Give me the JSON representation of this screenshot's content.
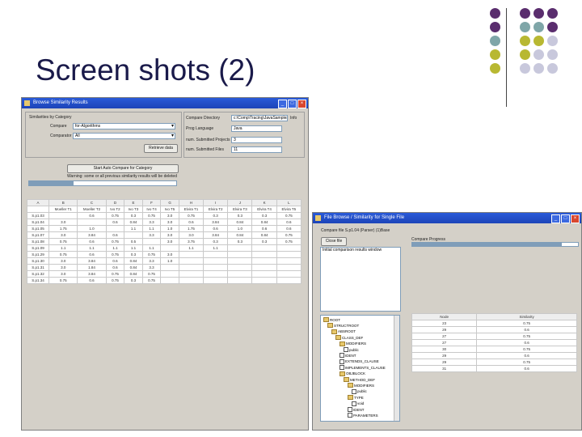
{
  "slide": {
    "title": "Screen shots (2)"
  },
  "colors": {
    "purple": "#5a2d6e",
    "teal": "#7fa6a8",
    "olive": "#b8b832",
    "lavender": "#c8c8dc",
    "titlebar": "#2a5ad8"
  },
  "win1": {
    "title": "Browse Similarity Results",
    "sim_group": "Similarities by Category",
    "compare_label": "Compare",
    "compare_value": "for-Algorithms",
    "comparator_label": "Comparator",
    "comparator_value": "All",
    "retrieve_btn": "Retrieve data",
    "compare_dir_label": "Compare Directory",
    "compare_dir_value": "c:\\Comp\\Tracing\\JavaSamples",
    "info_btn": "Info",
    "prog_lang_label": "Prog Language",
    "prog_lang_value": "Java",
    "num_projects_label": "num. Submitted Projects",
    "num_projects_value": "3",
    "num_files_label": "num. Submitted Files",
    "num_files_value": "11",
    "start_btn": "Start Auto Compare for Category",
    "warning": "Warning: some or all previous similarity results will be deleted",
    "progress": 0.3,
    "table": {
      "headers": [
        "A",
        "B",
        "C",
        "D",
        "E",
        "F",
        "G",
        "H",
        "I",
        "J",
        "K",
        "L"
      ],
      "subheaders": [
        "",
        "Moeller T1",
        "Moeller T2",
        "Ivo T2",
        "Ivo T3",
        "Ivo T4",
        "Ivo T5",
        "Elvira T1",
        "Elvira T2",
        "Elvira T3",
        "Elvira T4",
        "Elvira T5"
      ],
      "rows": [
        [
          "S.p1.03",
          "",
          "0.6",
          "0.75",
          "0.3",
          "0.75",
          "3.0",
          "0.75",
          "0.3",
          "0.3",
          "0.3",
          "0.75"
        ],
        [
          "S.p1.04",
          "3.0",
          "",
          "0.6",
          "0.84",
          "3.3",
          "3.0",
          "0.6",
          "3.84",
          "0.84",
          "0.84",
          "0.6"
        ],
        [
          "S.p1.05",
          "1.75",
          "1.0",
          "",
          "1.1",
          "1.1",
          "1.0",
          "1.75",
          "0.6",
          "1.0",
          "0.6",
          "0.6"
        ],
        [
          "S.p1.07",
          "3.0",
          "3.84",
          "0.6",
          "",
          "3.3",
          "3.0",
          "3.0",
          "3.84",
          "0.84",
          "0.84",
          "0.75"
        ],
        [
          "S.p1.08",
          "0.75",
          "0.6",
          "0.75",
          "0.5",
          "",
          "3.0",
          "3.75",
          "0.3",
          "0.3",
          "0.3",
          "0.75"
        ],
        [
          "S.p1.09",
          "1.1",
          "1.1",
          "1.1",
          "1.1",
          "1.1",
          "",
          "1.1",
          "1.1",
          "",
          "",
          ""
        ],
        [
          "S.p1.29",
          "0.75",
          "0.6",
          "0.75",
          "0.3",
          "0.75",
          "3.0",
          "",
          "",
          "",
          "",
          ""
        ],
        [
          "S.p1.30",
          "3.0",
          "3.84",
          "0.6",
          "0.84",
          "3.3",
          "1.0",
          "",
          "",
          "",
          "",
          ""
        ],
        [
          "S.p1.31",
          "3.0",
          "1.84",
          "0.6",
          "0.84",
          "3.3",
          "",
          "",
          "",
          "",
          "",
          ""
        ],
        [
          "S.p1.32",
          "3.0",
          "3.84",
          "0.75",
          "0.84",
          "0.75",
          "",
          "",
          "",
          "",
          "",
          ""
        ],
        [
          "S.p1.34",
          "0.75",
          "0.6",
          "0.75",
          "0.3",
          "0.75",
          "",
          "",
          "",
          "",
          "",
          ""
        ]
      ]
    }
  },
  "win2": {
    "title": "File Browse / Similarity for Single File",
    "compare_label": "Compare file S.p1.04 (Parser) (1)Base",
    "close_btn": "Close file",
    "progress_label": "Compare Progress",
    "progress": 0.9,
    "text_area": "Initial comparison results window",
    "score_headers": [
      "Node",
      "Similarity"
    ],
    "scores": [
      [
        "23",
        "0.75"
      ],
      [
        "29",
        "0.6"
      ],
      [
        "27",
        "0.75"
      ],
      [
        "27",
        "0.6"
      ],
      [
        "30",
        "0.75"
      ],
      [
        "29",
        "0.6"
      ],
      [
        "29",
        "0.75"
      ],
      [
        "31",
        "0.6"
      ]
    ],
    "tree": [
      {
        "label": "ROOT",
        "depth": 0,
        "type": "folder"
      },
      {
        "label": "STRUCTROOT",
        "depth": 1,
        "type": "folder"
      },
      {
        "label": "ABSROOT",
        "depth": 2,
        "type": "folder"
      },
      {
        "label": "CLASS_DEF",
        "depth": 3,
        "type": "folder"
      },
      {
        "label": "MODIFIERS",
        "depth": 4,
        "type": "folder"
      },
      {
        "label": "public",
        "depth": 5,
        "type": "file"
      },
      {
        "label": "IDENT",
        "depth": 4,
        "type": "file"
      },
      {
        "label": "EXTENDS_CLAUSE",
        "depth": 4,
        "type": "file"
      },
      {
        "label": "IMPLEMENTS_CLAUSE",
        "depth": 4,
        "type": "file"
      },
      {
        "label": "OBJBLOCK",
        "depth": 4,
        "type": "folder"
      },
      {
        "label": "METHOD_DEF",
        "depth": 5,
        "type": "folder"
      },
      {
        "label": "MODIFIERS",
        "depth": 6,
        "type": "folder"
      },
      {
        "label": "public",
        "depth": 7,
        "type": "file"
      },
      {
        "label": "TYPE",
        "depth": 6,
        "type": "folder"
      },
      {
        "label": "void",
        "depth": 7,
        "type": "file"
      },
      {
        "label": "IDENT",
        "depth": 6,
        "type": "file"
      },
      {
        "label": "PARAMETERS",
        "depth": 6,
        "type": "file"
      }
    ]
  }
}
